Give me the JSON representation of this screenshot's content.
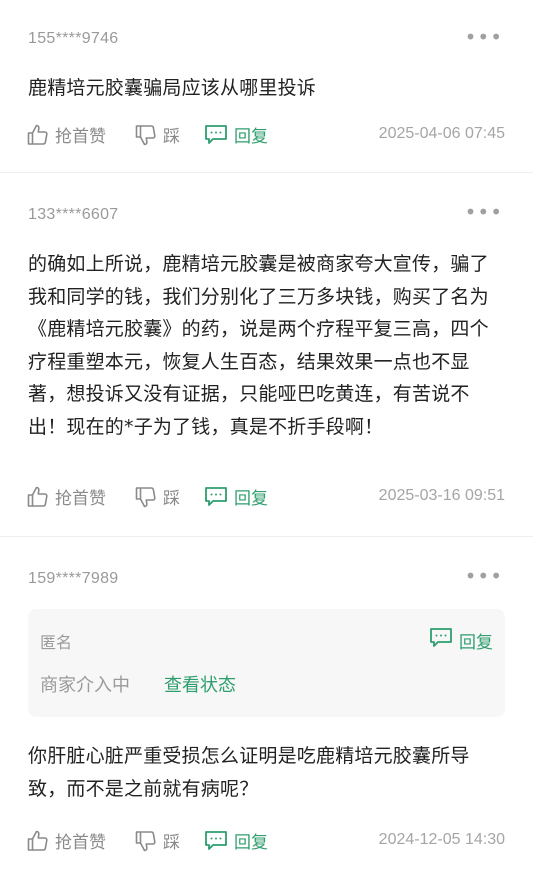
{
  "comments": [
    {
      "user": "155****9746",
      "text": "鹿精培元胶囊骗局应该从哪里投诉",
      "like_label": "抢首赞",
      "dislike_label": "踩",
      "reply_label": "回复",
      "date": "2025-04-06 07:45"
    },
    {
      "user": "133****6607",
      "text": "的确如上所说，鹿精培元胶囊是被商家夸大宣传，骗了我和同学的钱，我们分别化了三万多块钱，购买了名为《鹿精培元胶囊》的药，说是两个疗程平复三高，四个疗程重塑本元，恢复人生百态，结果效果一点也不显著，想投诉又没有证据，只能哑巴吃黄连，有苦说不出！现在的*子为了钱，真是不折手段啊！",
      "like_label": "抢首赞",
      "dislike_label": "踩",
      "reply_label": "回复",
      "date": "2025-03-16 09:51"
    },
    {
      "user": "159****7989",
      "reply_box": {
        "name": "匿名",
        "reply_label": "回复",
        "status": "商家介入中",
        "status_link": "查看状态"
      },
      "text": "你肝脏心脏严重受损怎么证明是吃鹿精培元胶囊所导致，而不是之前就有病呢？",
      "like_label": "抢首赞",
      "dislike_label": "踩",
      "reply_label": "回复",
      "date": "2024-12-05 14:30"
    }
  ],
  "more_glyph": "•••",
  "colors": {
    "accent": "#2e9e6e",
    "muted": "#9a9a9a",
    "text": "#222222"
  }
}
